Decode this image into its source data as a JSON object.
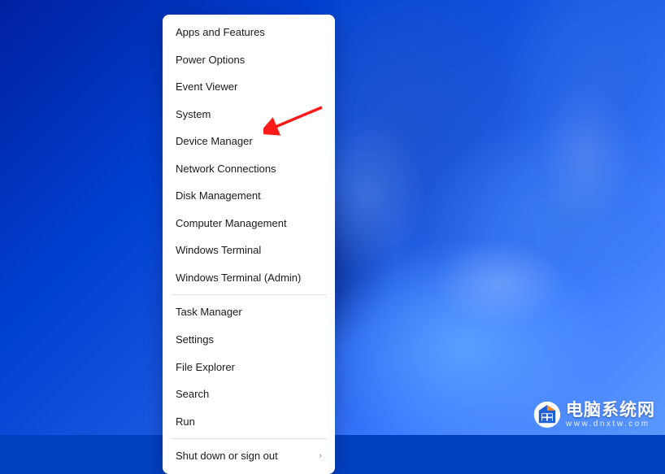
{
  "menu": {
    "groups": [
      [
        {
          "label": "Apps and Features",
          "name": "menu-item-apps-features"
        },
        {
          "label": "Power Options",
          "name": "menu-item-power-options"
        },
        {
          "label": "Event Viewer",
          "name": "menu-item-event-viewer"
        },
        {
          "label": "System",
          "name": "menu-item-system"
        },
        {
          "label": "Device Manager",
          "name": "menu-item-device-manager"
        },
        {
          "label": "Network Connections",
          "name": "menu-item-network-connections"
        },
        {
          "label": "Disk Management",
          "name": "menu-item-disk-management"
        },
        {
          "label": "Computer Management",
          "name": "menu-item-computer-management"
        },
        {
          "label": "Windows Terminal",
          "name": "menu-item-windows-terminal"
        },
        {
          "label": "Windows Terminal (Admin)",
          "name": "menu-item-windows-terminal-admin"
        }
      ],
      [
        {
          "label": "Task Manager",
          "name": "menu-item-task-manager"
        },
        {
          "label": "Settings",
          "name": "menu-item-settings"
        },
        {
          "label": "File Explorer",
          "name": "menu-item-file-explorer"
        },
        {
          "label": "Search",
          "name": "menu-item-search"
        },
        {
          "label": "Run",
          "name": "menu-item-run"
        }
      ],
      [
        {
          "label": "Shut down or sign out",
          "name": "menu-item-shutdown",
          "submenu": true
        }
      ]
    ]
  },
  "annotation": {
    "arrow_color": "#ff0000",
    "target": "menu-item-device-manager"
  },
  "watermark": {
    "title": "电脑系统网",
    "url": "www.dnxtw.com"
  }
}
